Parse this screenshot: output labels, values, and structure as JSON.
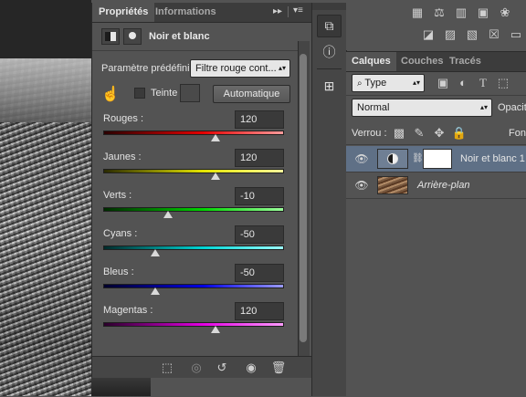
{
  "properties_panel": {
    "tabs": [
      {
        "label": "Propriétés",
        "active": true
      },
      {
        "label": "Informations",
        "active": false
      }
    ],
    "collapse_glyph": "▸▸",
    "menu_glyph": "▾≡",
    "title": "Noir et blanc",
    "preset_label": "Paramètre prédéfini :",
    "preset_value": "Filtre rouge cont...",
    "tint_label": "Teinte",
    "tint_checked": false,
    "auto_button": "Automatique",
    "sliders": [
      {
        "label": "Rouges :",
        "value": "120",
        "level": 0.62,
        "gradient": [
          "#2a0000",
          "#e30000",
          "#ff9b9b"
        ]
      },
      {
        "label": "Jaunes :",
        "value": "120",
        "level": 0.62,
        "gradient": [
          "#2a2a00",
          "#e3e300",
          "#ffff9b"
        ]
      },
      {
        "label": "Verts :",
        "value": "-10",
        "level": 0.36,
        "gradient": [
          "#002a00",
          "#00d400",
          "#9bff9b"
        ]
      },
      {
        "label": "Cyans :",
        "value": "-50",
        "level": 0.29,
        "gradient": [
          "#002a2a",
          "#00d4d4",
          "#9bffff"
        ]
      },
      {
        "label": "Bleus :",
        "value": "-50",
        "level": 0.29,
        "gradient": [
          "#00002a",
          "#0000e3",
          "#9b9bff"
        ]
      },
      {
        "label": "Magentas :",
        "value": "120",
        "level": 0.62,
        "gradient": [
          "#2a002a",
          "#e300e3",
          "#ff9bff"
        ]
      }
    ],
    "footer_icons": [
      "clip-to-layer-icon",
      "view-previous-state-icon",
      "reset-icon",
      "visibility-icon",
      "delete-icon"
    ]
  },
  "layers_panel": {
    "tabs": [
      {
        "label": "Calques",
        "active": true
      },
      {
        "label": "Couches",
        "active": false
      },
      {
        "label": "Tracés",
        "active": false
      }
    ],
    "filter_value": "Type",
    "blend_mode": "Normal",
    "opacity_label": "Opacité",
    "lock_label": "Verrou :",
    "fill_label": "Fond",
    "layers": [
      {
        "name": "Noir et blanc 1",
        "italic": false,
        "selected": true
      },
      {
        "name": "Arrière-plan",
        "italic": true,
        "selected": false
      }
    ]
  },
  "colors": {
    "panel_bg": "#535353",
    "tabbar_bg": "#3c3c3c",
    "accent_selected": "#5f7086"
  }
}
